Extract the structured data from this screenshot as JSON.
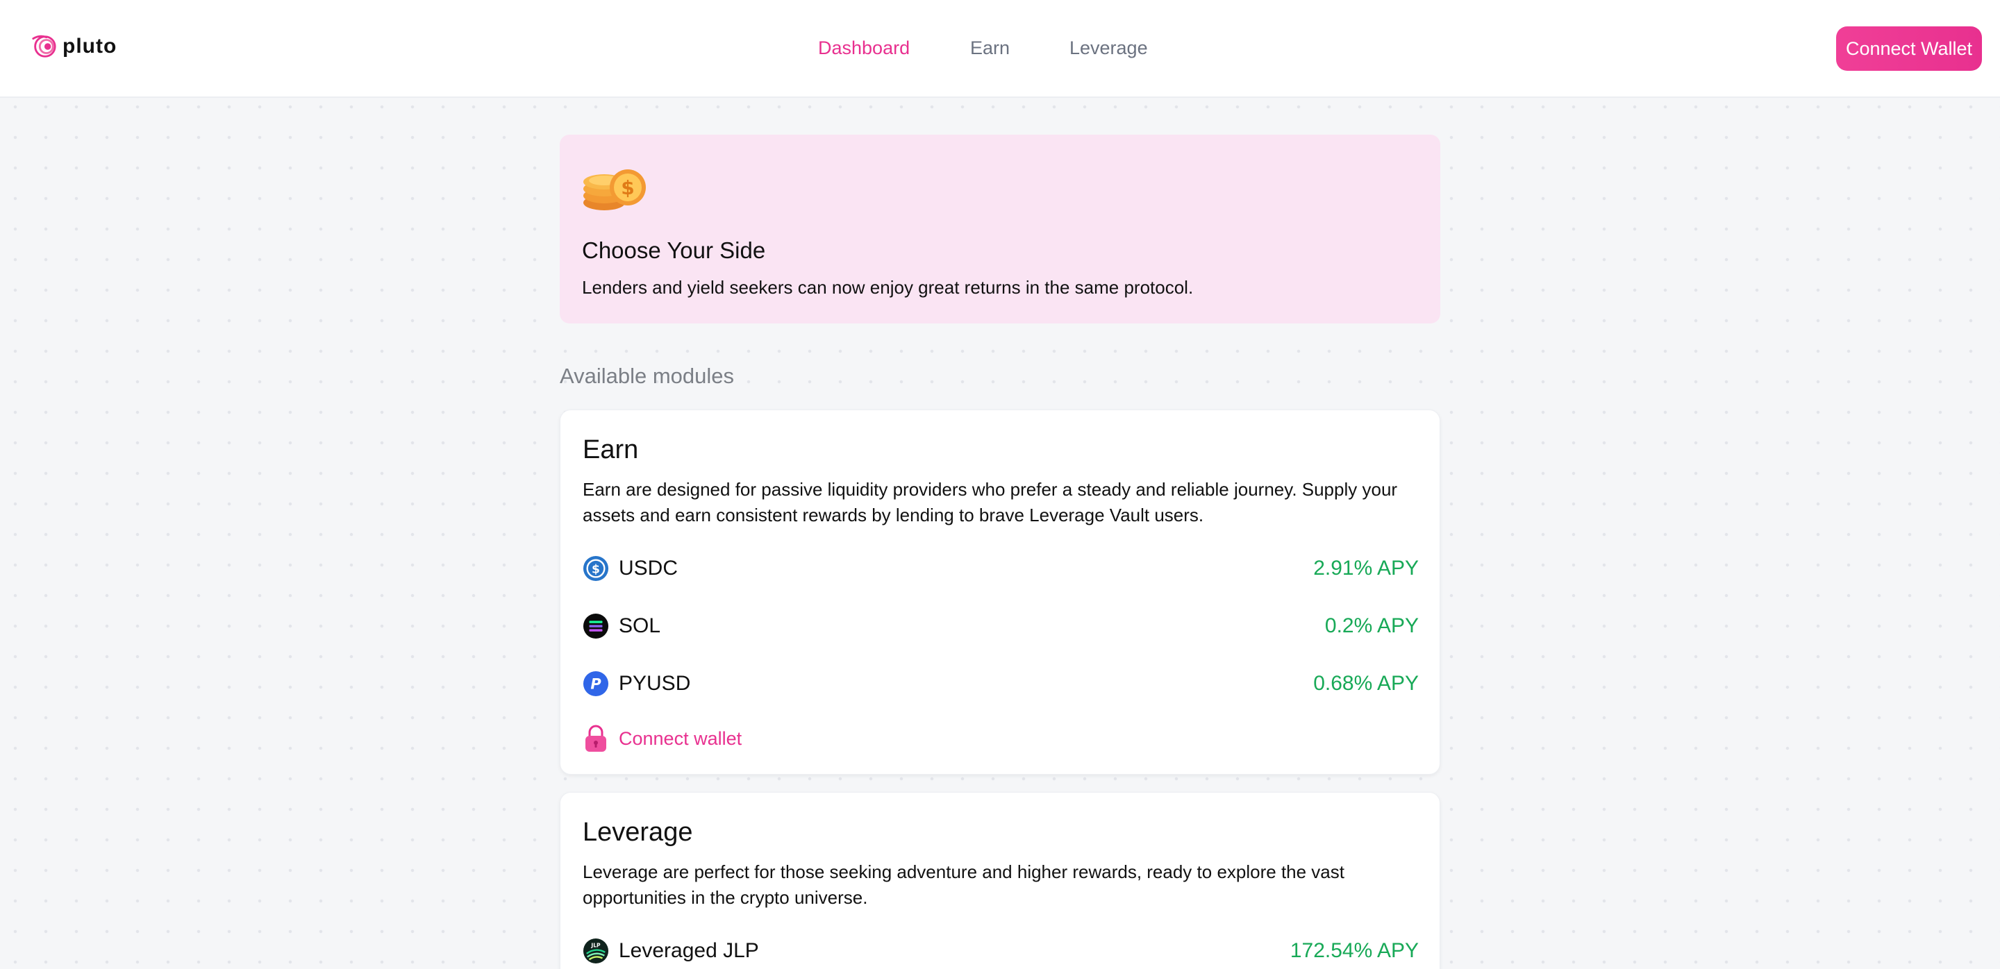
{
  "header": {
    "logo_text": "pluto",
    "nav": [
      {
        "label": "Dashboard",
        "active": true
      },
      {
        "label": "Earn",
        "active": false
      },
      {
        "label": "Leverage",
        "active": false
      }
    ],
    "connect_button": "Connect Wallet"
  },
  "hero": {
    "icon": "coins-icon",
    "title": "Choose Your Side",
    "subtitle": "Lenders and yield seekers can now enjoy great returns in the same protocol."
  },
  "modules": {
    "section_title": "Available modules",
    "earn": {
      "title": "Earn",
      "description": "Earn are designed for passive liquidity providers who prefer a steady and reliable journey. Supply your assets and earn consistent rewards by lending to brave Leverage Vault users.",
      "assets": [
        {
          "name": "USDC",
          "apy": "2.91% APY",
          "icon": "usdc-icon"
        },
        {
          "name": "SOL",
          "apy": "0.2% APY",
          "icon": "sol-icon"
        },
        {
          "name": "PYUSD",
          "apy": "0.68% APY",
          "icon": "pyusd-icon"
        }
      ],
      "connect_link": "Connect wallet"
    },
    "leverage": {
      "title": "Leverage",
      "description": "Leverage are perfect for those seeking adventure and higher rewards, ready to explore the vast opportunities in the crypto universe.",
      "assets": [
        {
          "name": "Leveraged JLP",
          "apy": "172.54% APY",
          "icon": "jlp-icon"
        }
      ]
    }
  },
  "colors": {
    "accent": "#e8308f",
    "apy_green": "#18a957",
    "hero_bg": "#fae4f3"
  }
}
